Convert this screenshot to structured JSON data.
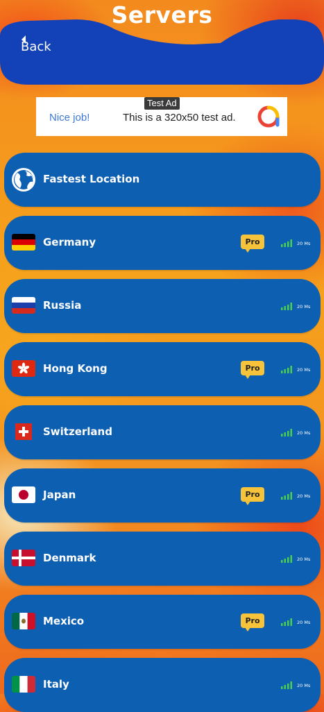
{
  "page": {
    "title": "Servers"
  },
  "header": {
    "back_label": "Back"
  },
  "ad": {
    "label": "Test Ad",
    "title": "Nice job!",
    "text": "This is a 320x50 test ad."
  },
  "fastest": {
    "name": "Fastest Location"
  },
  "servers": [
    {
      "name": "Germany",
      "pro": "Pro",
      "latency": "20 Ms"
    },
    {
      "name": "Russia",
      "pro": "",
      "latency": "20 Ms"
    },
    {
      "name": "Hong Kong",
      "pro": "Pro",
      "latency": "20 Ms"
    },
    {
      "name": "Switzerland",
      "pro": "",
      "latency": "20 Ms"
    },
    {
      "name": "Japan",
      "pro": "Pro",
      "latency": "20 Ms"
    },
    {
      "name": "Denmark",
      "pro": "",
      "latency": "20 Ms"
    },
    {
      "name": "Mexico",
      "pro": "Pro",
      "latency": "20 Ms"
    },
    {
      "name": "Italy",
      "pro": "",
      "latency": "20 Ms"
    }
  ],
  "colors": {
    "row_bg": "#0d5fb2",
    "header_bg": "#1341b8",
    "pro_badge": "#f7c33a",
    "signal": "#4ccf4c"
  }
}
